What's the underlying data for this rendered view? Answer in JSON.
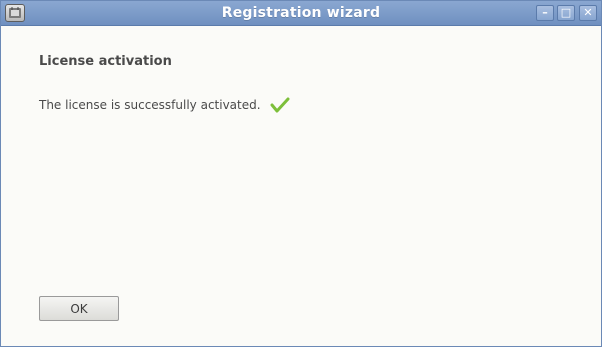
{
  "window": {
    "title": "Registration wizard",
    "controls": {
      "minimize": "–",
      "maximize": "□",
      "close": "✕"
    }
  },
  "main": {
    "heading": "License activation",
    "message": "The license is successfully activated.",
    "status_icon": "checkmark-icon",
    "ok_label": "OK"
  },
  "colors": {
    "titlebar": "#7b9bc9",
    "check": "#7dbf3a"
  }
}
